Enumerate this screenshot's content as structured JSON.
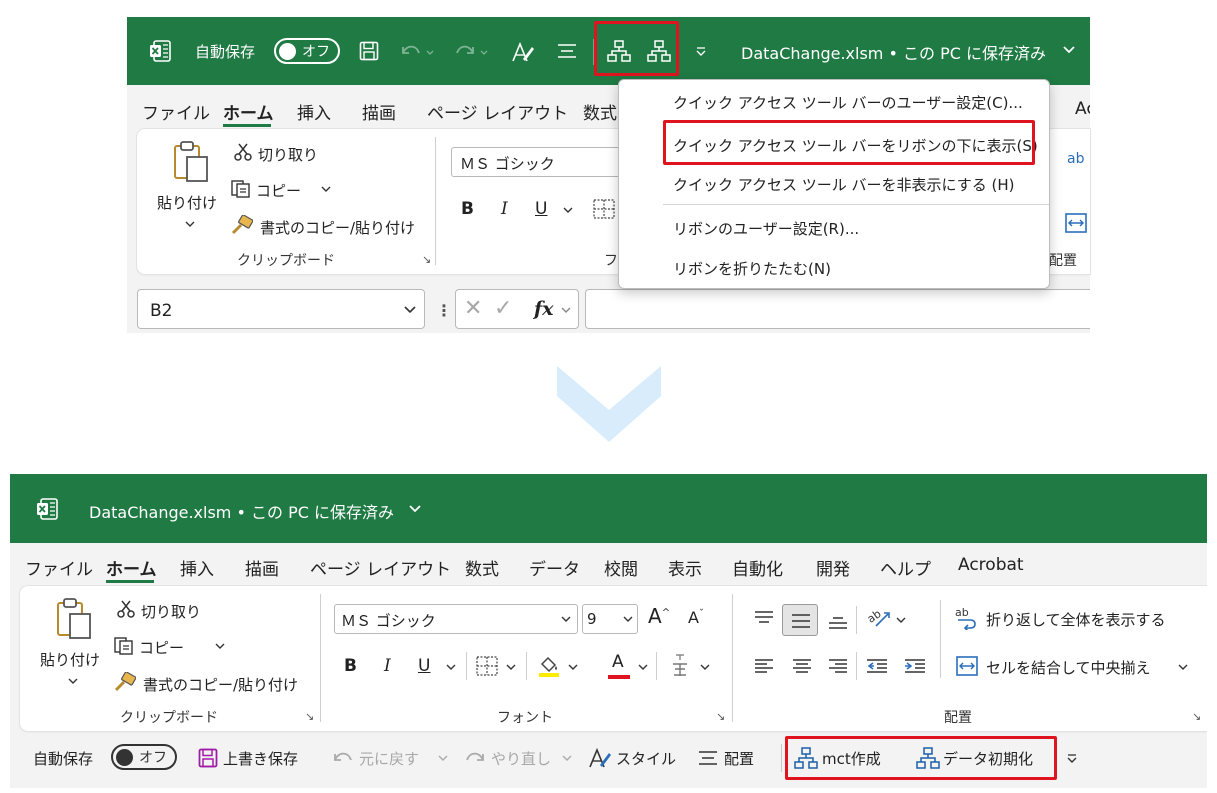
{
  "top": {
    "autosave_label": "自動保存",
    "toggle_label": "オフ",
    "file_title": "DataChange.xlsm • この PC に保存済み",
    "tabs": [
      "ファイル",
      "ホーム",
      "挿入",
      "描画",
      "ページ レイアウト",
      "数式"
    ],
    "tab_cut_label": "Ac",
    "clipboard": {
      "paste": "貼り付け",
      "cut": "切り取り",
      "copy": "コピー",
      "format_painter": "書式のコピー/貼り付け",
      "group": "クリップボード"
    },
    "font_name": "ＭＳ ゴシック",
    "font_group_partial": "フ",
    "align_group_partial": "配置",
    "name_box": "B2",
    "fx": "fx",
    "context_menu": [
      "クイック アクセス ツール バーのユーザー設定(C)...",
      "クイック アクセス ツール バーをリボンの下に表示(S)",
      "クイック アクセス ツール バーを非表示にする (H)",
      "リボンのユーザー設定(R)...",
      "リボンを折りたたむ(N)"
    ]
  },
  "bottom": {
    "file_title": "DataChange.xlsm • この PC に保存済み",
    "tabs": [
      "ファイル",
      "ホーム",
      "挿入",
      "描画",
      "ページ レイアウト",
      "数式",
      "データ",
      "校閲",
      "表示",
      "自動化",
      "開発",
      "ヘルプ",
      "Acrobat"
    ],
    "clipboard": {
      "paste": "貼り付け",
      "cut": "切り取り",
      "copy": "コピー",
      "format_painter": "書式のコピー/貼り付け",
      "group": "クリップボード"
    },
    "font": {
      "name": "ＭＳ ゴシック",
      "size": "9",
      "bold": "B",
      "italic": "I",
      "underline": "U",
      "font_color": "A",
      "group": "フォント"
    },
    "alignment": {
      "wrap": "折り返して全体を表示する",
      "merge": "セルを結合して中央揃え",
      "group": "配置"
    },
    "qat": {
      "autosave": "自動保存",
      "toggle": "オフ",
      "save": "上書き保存",
      "undo": "元に戻す",
      "redo": "やり直し",
      "style": "スタイル",
      "align": "配置",
      "mct": "mct作成",
      "init": "データ初期化"
    }
  },
  "colors": {
    "excel_green": "#1f7a44",
    "highlight_red": "#e0141e",
    "arrow_blue": "#d8ecfb",
    "save_purple": "#a11ca6"
  }
}
